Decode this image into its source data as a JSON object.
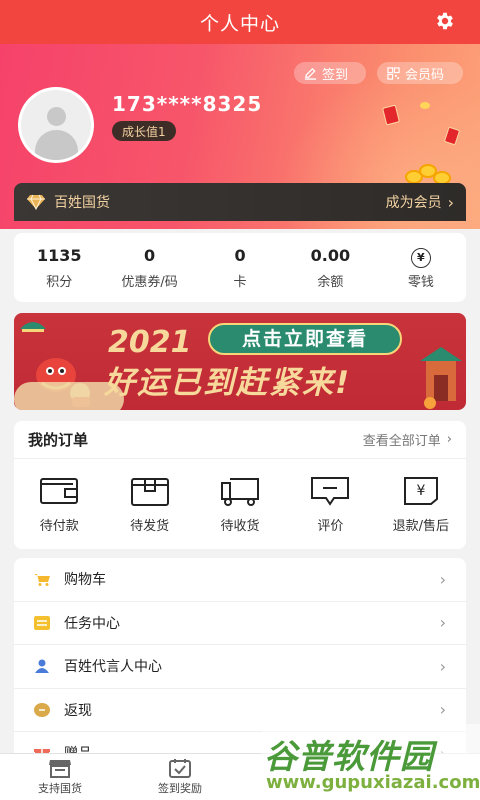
{
  "header": {
    "title": "个人中心",
    "settings_icon": "gear-icon"
  },
  "profile": {
    "sign_label": "签到",
    "member_code_label": "会员码",
    "phone": "173****8325",
    "growth_label": "成长值1"
  },
  "vip": {
    "brand": "百姓国货",
    "join_label": "成为会员"
  },
  "stats": [
    {
      "value": "1135",
      "label": "积分"
    },
    {
      "value": "0",
      "label": "优惠券/码"
    },
    {
      "value": "0",
      "label": "卡"
    },
    {
      "value": "0.00",
      "label": "余额"
    },
    {
      "value": "¥",
      "label": "零钱"
    }
  ],
  "banner": {
    "button": "点击立即查看",
    "year": "2021",
    "slogan": "好运已到赶紧来!"
  },
  "orders": {
    "title": "我的订单",
    "view_all": "查看全部订单",
    "items": [
      {
        "label": "待付款",
        "icon": "wallet-icon"
      },
      {
        "label": "待发货",
        "icon": "box-icon"
      },
      {
        "label": "待收货",
        "icon": "truck-icon"
      },
      {
        "label": "评价",
        "icon": "comment-icon"
      },
      {
        "label": "退款/售后",
        "icon": "refund-icon"
      }
    ]
  },
  "menu": [
    {
      "label": "购物车",
      "icon": "cart-icon",
      "color": "#f5b82e"
    },
    {
      "label": "任务中心",
      "icon": "task-icon",
      "color": "#f5c02e"
    },
    {
      "label": "百姓代言人中心",
      "icon": "user-icon",
      "color": "#4a7bd8"
    },
    {
      "label": "返现",
      "icon": "cashback-icon",
      "color": "#d9a94a"
    },
    {
      "label": "赠品",
      "icon": "gift-icon",
      "color": "#f06a5a"
    }
  ],
  "tabs": [
    {
      "label": "支持国货"
    },
    {
      "label": "签到奖励"
    }
  ],
  "watermark": {
    "title": "谷普软件园",
    "url": "www.gupuxiazai.com"
  }
}
